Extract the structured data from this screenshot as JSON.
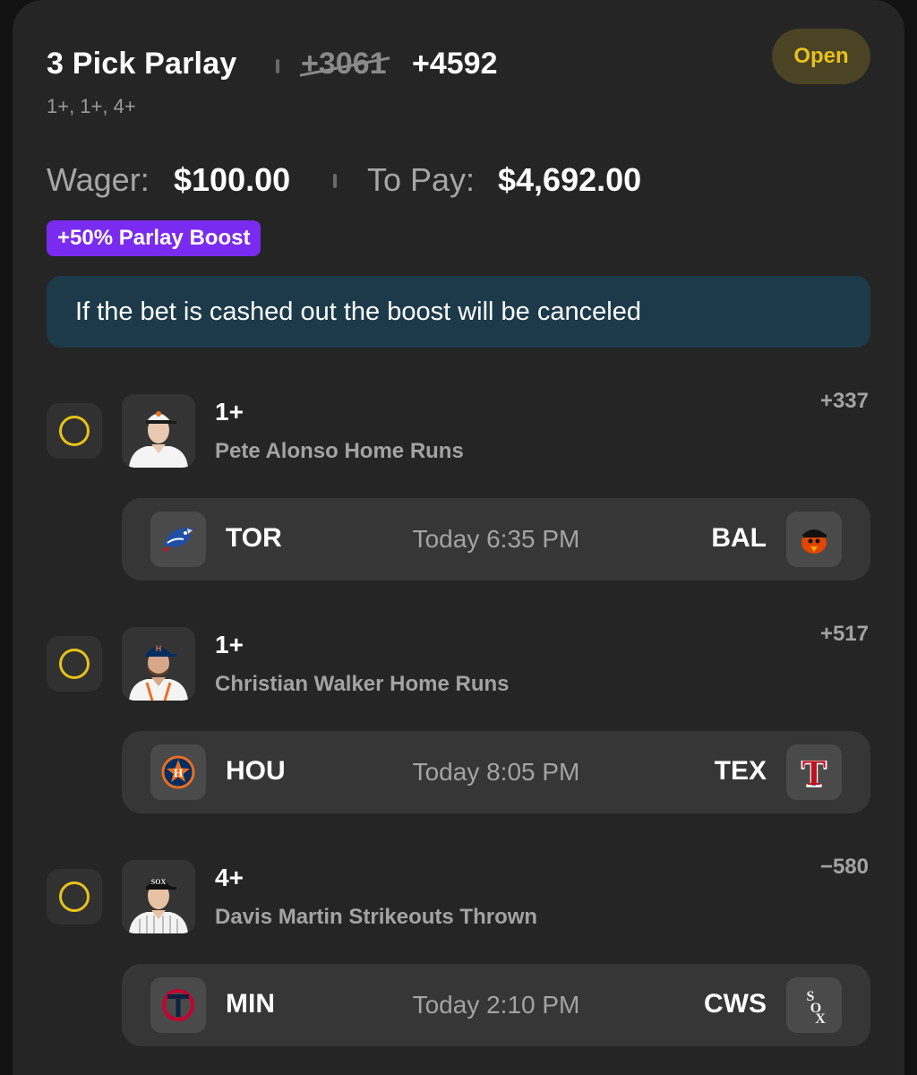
{
  "header": {
    "title": "3 Pick Parlay",
    "old_odds": "+3061",
    "new_odds": "+4592",
    "subtitle": "1+, 1+, 4+",
    "status": "Open"
  },
  "wager": {
    "wager_label": "Wager:",
    "wager_value": "$100.00",
    "pay_label": "To Pay:",
    "pay_value": "$4,692.00"
  },
  "boost_badge": "+50% Parlay Boost",
  "notice": "If the bet is cashed out the boost will be canceled",
  "colors": {
    "accent_yellow": "#e8c21a",
    "boost_purple": "#7a2bf0",
    "notice_bg": "#1c3a4a"
  },
  "legs": [
    {
      "line": "1+",
      "market": "Pete Alonso Home Runs",
      "odds": "+337",
      "away_team": "TOR",
      "away_logo": "blue-jays-logo",
      "time": "Today 6:35 PM",
      "home_team": "BAL",
      "home_logo": "orioles-logo"
    },
    {
      "line": "1+",
      "market": "Christian Walker Home Runs",
      "odds": "+517",
      "away_team": "HOU",
      "away_logo": "astros-logo",
      "time": "Today 8:05 PM",
      "home_team": "TEX",
      "home_logo": "rangers-logo"
    },
    {
      "line": "4+",
      "market": "Davis Martin Strikeouts Thrown",
      "odds": "−580",
      "away_team": "MIN",
      "away_logo": "twins-logo",
      "time": "Today 2:10 PM",
      "home_team": "CWS",
      "home_logo": "white-sox-logo"
    }
  ]
}
